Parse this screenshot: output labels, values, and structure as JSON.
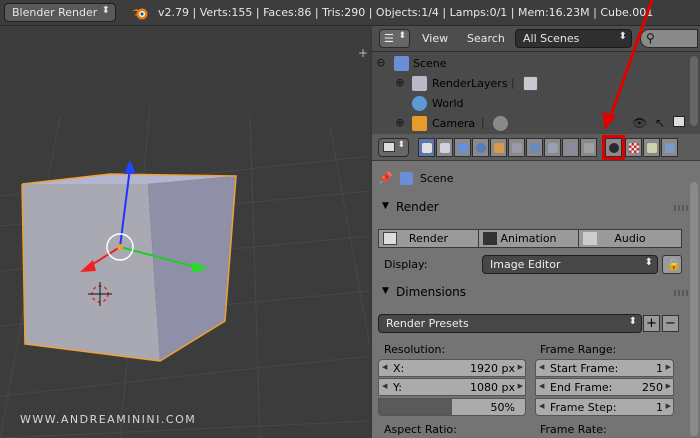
{
  "topbar": {
    "engine": "Blender Render",
    "stats": "v2.79 | Verts:155 | Faces:86 | Tris:290 | Objects:1/4 | Lamps:0/1 | Mem:16.23M | Cube.001"
  },
  "viewport": {
    "watermark": "WWW.ANDREAMININI.COM",
    "plus_label": "+"
  },
  "outliner": {
    "menu_view": "View",
    "menu_search": "Search",
    "scenes_select": "All Scenes",
    "tree": [
      {
        "label": "Scene"
      },
      {
        "label": "RenderLayers"
      },
      {
        "label": "World"
      },
      {
        "label": "Camera"
      }
    ]
  },
  "properties": {
    "context_label": "Scene",
    "render_panel": {
      "title": "Render",
      "buttons": [
        "Render",
        "Animation",
        "Audio"
      ],
      "display_label": "Display:",
      "display_value": "Image Editor"
    },
    "dimensions_panel": {
      "title": "Dimensions",
      "presets": "Render Presets",
      "resolution_label": "Resolution:",
      "res_x_label": "X:",
      "res_x_value": "1920 px",
      "res_y_label": "Y:",
      "res_y_value": "1080 px",
      "res_pct": "50%",
      "frame_range_label": "Frame Range:",
      "start_label": "Start Frame:",
      "start_value": "1",
      "end_label": "End Frame:",
      "end_value": "250",
      "step_label": "Frame Step:",
      "step_value": "1",
      "aspect_label": "Aspect Ratio:",
      "frame_rate_label": "Frame Rate:"
    }
  },
  "colors": {
    "highlight": "#e00000",
    "selection_outline": "#f0a030",
    "active_tab": "#5c77a8"
  }
}
